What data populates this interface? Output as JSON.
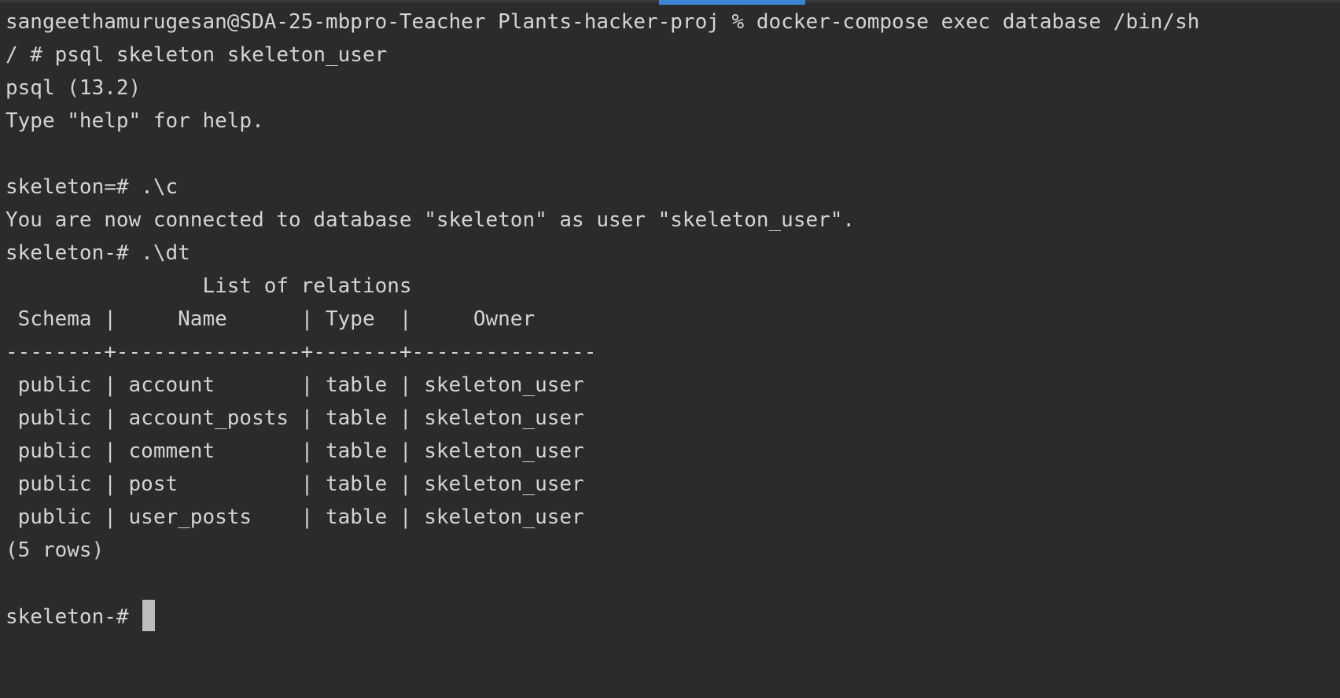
{
  "terminal": {
    "lines": {
      "cmd_exec": "sangeethamurugesan@SDA-25-mbpro-Teacher Plants-hacker-proj % docker-compose exec database /bin/sh",
      "cmd_psql": "/ # psql skeleton skeleton_user",
      "psql_version": "psql (13.2)",
      "help_hint": "Type \"help\" for help.",
      "prompt_connect": "skeleton=# .\\c",
      "connected_msg": "You are now connected to database \"skeleton\" as user \"skeleton_user\".",
      "prompt_dt": "skeleton-# .\\dt"
    },
    "table": {
      "title": "                List of relations",
      "header": " Schema |     Name      | Type  |     Owner",
      "separator": "--------+---------------+-------+---------------",
      "rows": [
        " public | account       | table | skeleton_user",
        " public | account_posts | table | skeleton_user",
        " public | comment       | table | skeleton_user",
        " public | post          | table | skeleton_user",
        " public | user_posts    | table | skeleton_user"
      ],
      "footer": "(5 rows)"
    },
    "final_prompt": "skeleton-# ",
    "colors": {
      "background": "#2b2b2b",
      "text": "#d4d4d4",
      "cursor": "#bdbdbd",
      "active_tab": "#3d84d6"
    }
  }
}
